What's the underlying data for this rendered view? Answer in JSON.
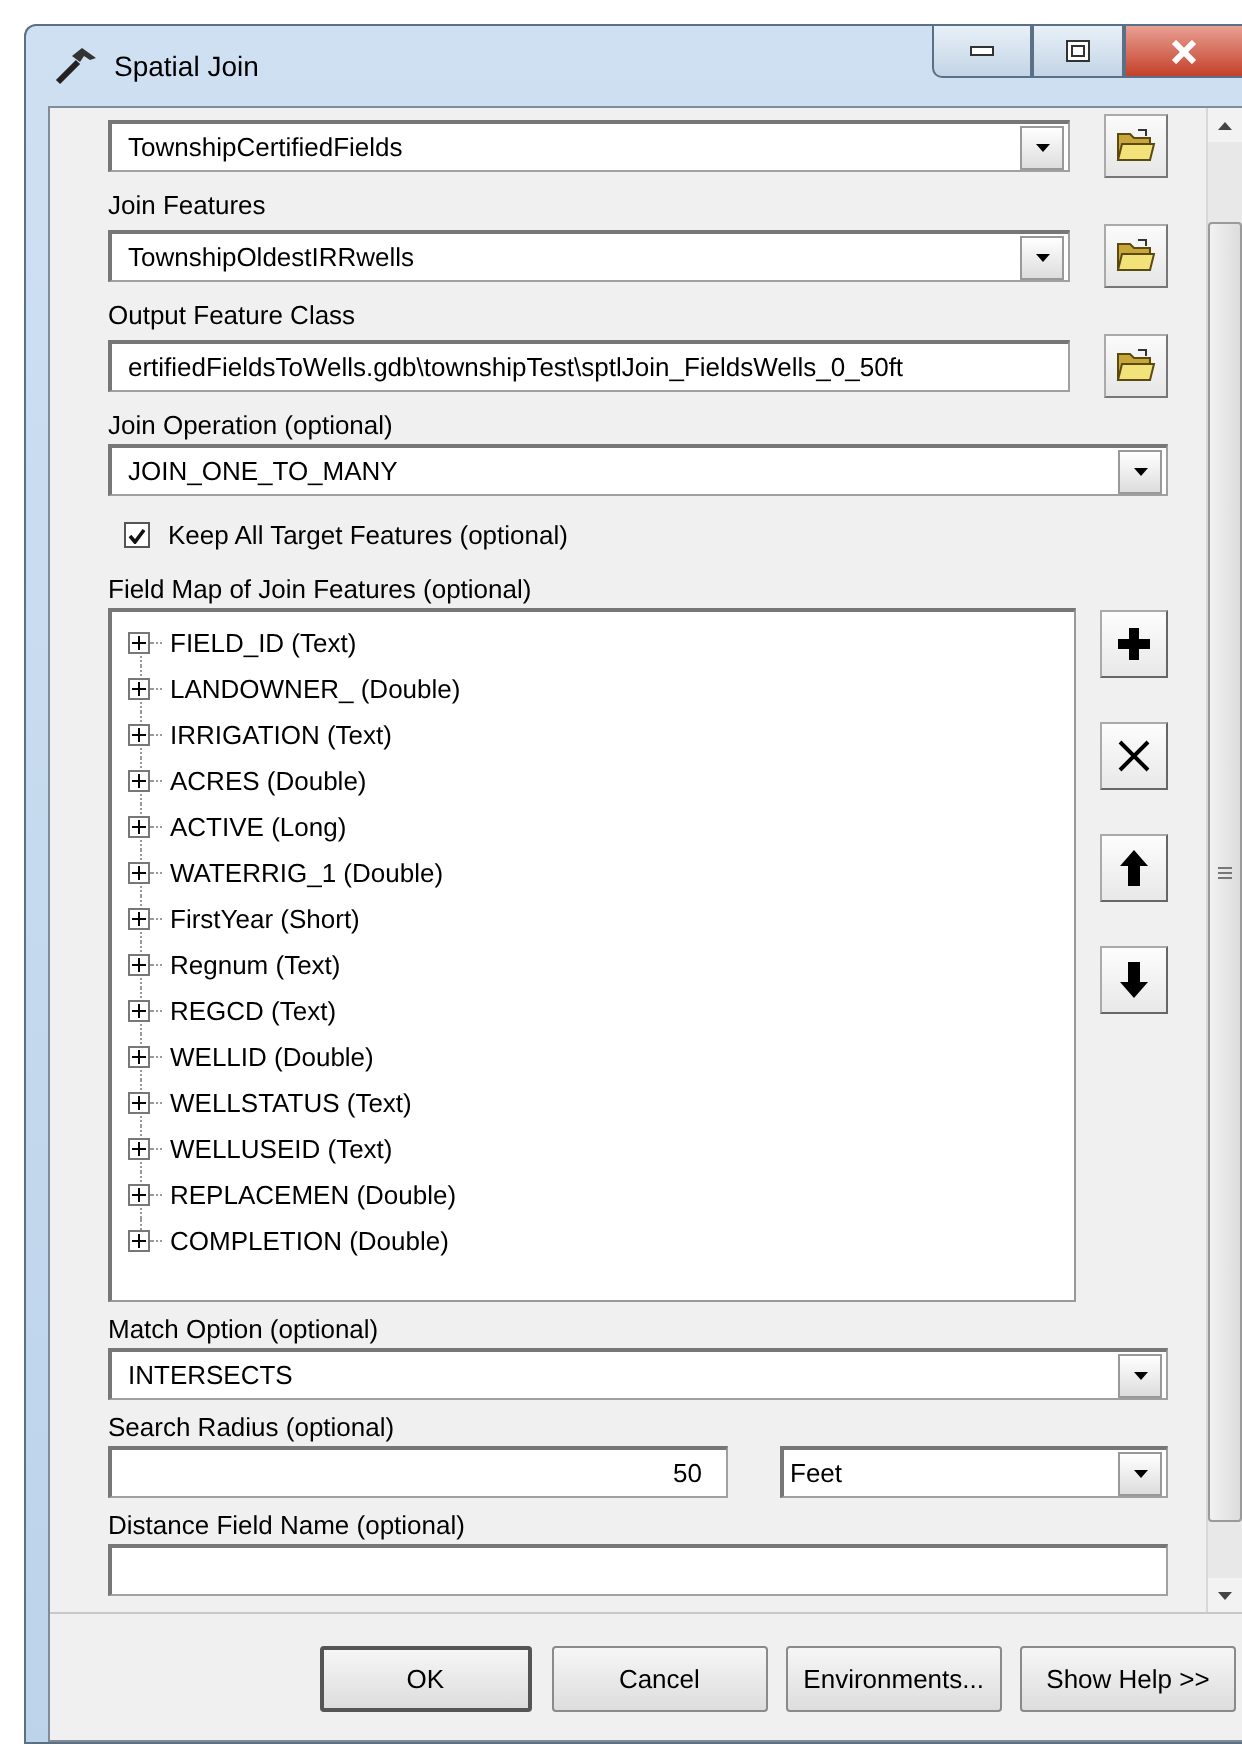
{
  "window": {
    "title": "Spatial Join"
  },
  "parameters": [
    {
      "kind": "dropdown",
      "value": "TownshipCertifiedFields",
      "browse": true
    },
    {
      "kind": "dropdown",
      "label": "Join Features",
      "value": "TownshipOldestIRRwells",
      "browse": true
    },
    {
      "kind": "text",
      "label": "Output Feature Class",
      "value": "ertifiedFieldsToWells.gdb\\townshipTest\\sptlJoin_FieldsWells_0_50ft",
      "browse": true
    },
    {
      "kind": "dropdown",
      "label": "Join Operation (optional)",
      "value": "JOIN_ONE_TO_MANY",
      "browse": false
    },
    {
      "kind": "checkbox",
      "label": "Keep All Target Features (optional)",
      "checked": true
    },
    {
      "kind": "field_map",
      "label": "Field Map of Join Features (optional)",
      "items": [
        {
          "label": "FIELD_ID (Text)",
          "expanded": false
        },
        {
          "label": "LANDOWNER_ (Double)",
          "expanded": false
        },
        {
          "label": "IRRIGATION (Text)",
          "expanded": false
        },
        {
          "label": "ACRES (Double)",
          "expanded": false
        },
        {
          "label": "ACTIVE (Long)",
          "expanded": false
        },
        {
          "label": "WATERRIG_1 (Double)",
          "expanded": false
        },
        {
          "label": "FirstYear (Short)",
          "expanded": false
        },
        {
          "label": "Regnum (Text)",
          "expanded": false
        },
        {
          "label": "REGCD (Text)",
          "expanded": false
        },
        {
          "label": "WELLID (Double)",
          "expanded": false
        },
        {
          "label": "WELLSTATUS (Text)",
          "expanded": false
        },
        {
          "label": "WELLUSEID (Text)",
          "expanded": false
        },
        {
          "label": "REPLACEMEN (Double)",
          "expanded": false
        },
        {
          "label": "COMPLETION (Double)",
          "expanded": false
        }
      ]
    },
    {
      "kind": "dropdown",
      "label": "Match Option (optional)",
      "value": "INTERSECTS",
      "browse": false
    },
    {
      "kind": "linear_unit",
      "label": "Search Radius (optional)",
      "value": "50",
      "unit": "Feet"
    },
    {
      "kind": "text",
      "label": "Distance Field Name (optional)",
      "browse": false
    }
  ],
  "buttons": [
    "OK",
    "Cancel",
    "Environments...",
    "Show Help >>"
  ]
}
